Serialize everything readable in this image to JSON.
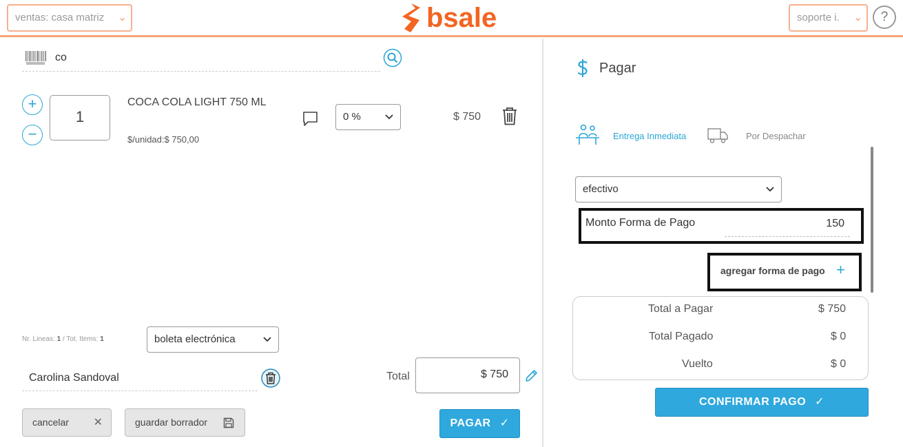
{
  "header": {
    "branch_select": "ventas: casa matriz",
    "logo_text": "bsale",
    "user_select": "soporte i.",
    "help_label": "?"
  },
  "search": {
    "value": "co"
  },
  "item": {
    "quantity": "1",
    "name": "COCA COLA LIGHT 750 ML",
    "unit_price": "$/unidad:$ 750,00",
    "discount": "0 %",
    "price": "$ 750"
  },
  "summary": {
    "lines_label": "Nr. Lineas:",
    "lines_value": "1",
    "items_label": "/ Tot. Items:",
    "items_value": "1"
  },
  "document_type": "boleta electrónica",
  "customer": "Carolina Sandoval",
  "total": {
    "label": "Total",
    "value": "$ 750"
  },
  "buttons": {
    "cancel": "cancelar",
    "save_draft": "guardar borrador",
    "pay": "PAGAR"
  },
  "payment": {
    "title": "Pagar",
    "tab_immediate": "Entrega Inmediata",
    "tab_dispatch": "Por Despachar",
    "method": "efectivo",
    "amount_label": "Monto Forma de Pago",
    "amount_value": "150",
    "add_method": "agregar forma de pago",
    "rows": [
      {
        "label": "Total a Pagar",
        "value": "$ 750"
      },
      {
        "label": "Total Pagado",
        "value": "$ 0"
      },
      {
        "label": "Vuelto",
        "value": "$ 0"
      }
    ],
    "confirm": "CONFIRMAR PAGO"
  },
  "colors": {
    "brand": "#f26522",
    "accent": "#2ea8dd"
  }
}
